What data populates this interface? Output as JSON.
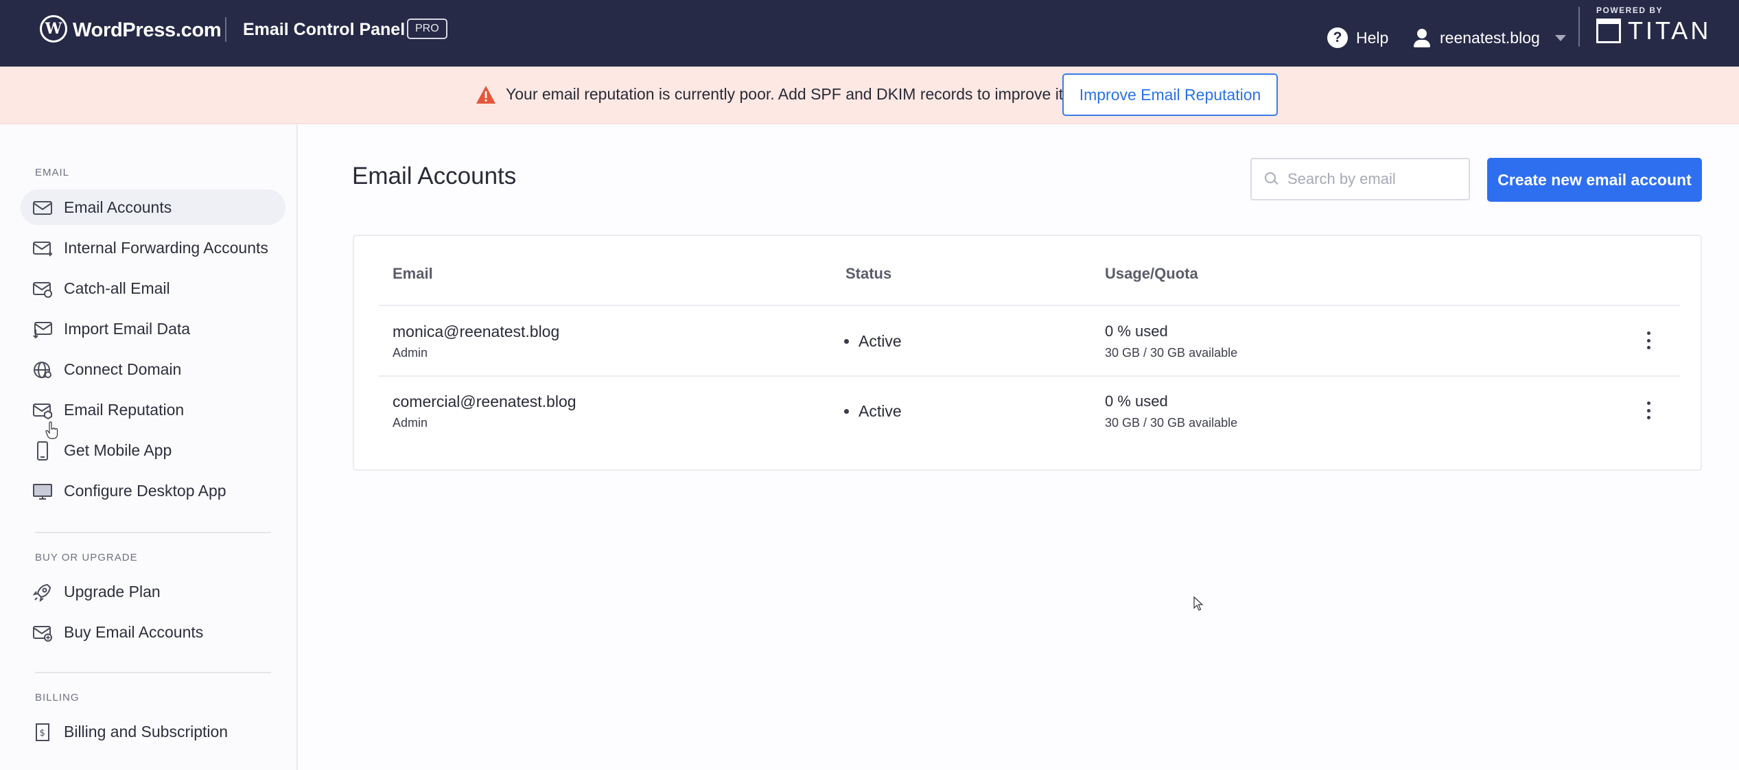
{
  "header": {
    "brand": "WordPress.com",
    "panel_title": "Email Control Panel",
    "badge": "PRO",
    "help_label": "Help",
    "account_label": "reenatest.blog",
    "powered_by": "POWERED BY",
    "partner": "TITAN"
  },
  "alert": {
    "message": "Your email reputation is currently poor. Add SPF and DKIM records to improve it.",
    "button_label": "Improve Email Reputation"
  },
  "sidebar": {
    "sections": [
      {
        "label": "EMAIL",
        "items": [
          {
            "label": "Email Accounts",
            "icon": "envelope-icon",
            "active": true
          },
          {
            "label": "Internal Forwarding Accounts",
            "icon": "forward-mail-icon"
          },
          {
            "label": "Catch-all Email",
            "icon": "catch-all-icon"
          },
          {
            "label": "Import Email Data",
            "icon": "import-icon"
          },
          {
            "label": "Connect Domain",
            "icon": "globe-icon"
          },
          {
            "label": "Email Reputation",
            "icon": "reputation-icon"
          },
          {
            "label": "Get Mobile App",
            "icon": "mobile-icon"
          },
          {
            "label": "Configure Desktop App",
            "icon": "desktop-icon"
          }
        ]
      },
      {
        "label": "BUY OR UPGRADE",
        "items": [
          {
            "label": "Upgrade Plan",
            "icon": "rocket-icon"
          },
          {
            "label": "Buy Email Accounts",
            "icon": "add-mail-icon"
          }
        ]
      },
      {
        "label": "BILLING",
        "items": [
          {
            "label": "Billing and Subscription",
            "icon": "invoice-icon"
          }
        ]
      }
    ]
  },
  "main": {
    "title": "Email Accounts",
    "search_placeholder": "Search by email",
    "create_button": "Create new email account",
    "columns": [
      "Email",
      "Status",
      "Usage/Quota"
    ],
    "rows": [
      {
        "email": "monica@reenatest.blog",
        "role": "Admin",
        "status": "Active",
        "usage": "0 % used",
        "quota": "30 GB / 30 GB available"
      },
      {
        "email": "comercial@reenatest.blog",
        "role": "Admin",
        "status": "Active",
        "usage": "0 % used",
        "quota": "30 GB / 30 GB available"
      }
    ]
  },
  "colors": {
    "topbar": "#262a47",
    "alert_bg": "#fde8e4",
    "warning": "#e4573a",
    "primary": "#2e6ff0"
  }
}
